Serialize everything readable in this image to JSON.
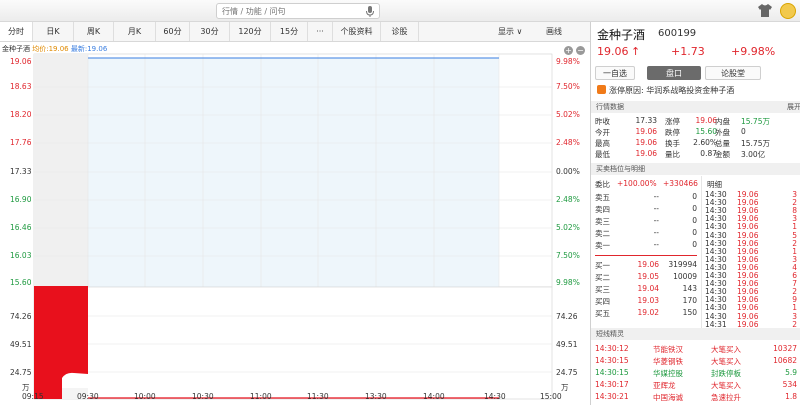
{
  "search": {
    "placeholder": "行情 / 功能 / 问句"
  },
  "tabs": [
    {
      "label": "分时",
      "active": true
    },
    {
      "label": "日K"
    },
    {
      "label": "周K"
    },
    {
      "label": "月K"
    },
    {
      "label": "60分"
    },
    {
      "label": "30分"
    },
    {
      "label": "120分"
    },
    {
      "label": "15分"
    },
    {
      "label": "···"
    },
    {
      "label": "个股资料"
    },
    {
      "label": "诊股"
    }
  ],
  "tab_dropdown": "显示 ∨",
  "tab_draw": "画线",
  "chart": {
    "legend_name": "金种子酒",
    "legend_avg": "均价:19.06",
    "legend_last": "最新:19.06",
    "price_levels": [
      "19.06",
      "18.63",
      "18.20",
      "17.76",
      "17.33",
      "16.90",
      "16.46",
      "16.03",
      "15.60"
    ],
    "pct_levels": [
      "9.98%",
      "7.50%",
      "5.02%",
      "2.48%",
      "0.00%",
      "2.48%",
      "5.02%",
      "7.50%",
      "9.98%"
    ],
    "vol_levels": [
      "74.26",
      "49.51",
      "24.75",
      "万"
    ],
    "time_labels": [
      "09:15",
      "09:30",
      "10:00",
      "10:30",
      "11:00",
      "11:30",
      "13:30",
      "14:00",
      "14:30",
      "15:00"
    ],
    "zoom_in": "+",
    "zoom_out": "−"
  },
  "chart_data": {
    "type": "line",
    "title": "金种子酒",
    "prev_close": 17.33,
    "x": [
      "09:15",
      "09:30",
      "10:00",
      "10:30",
      "11:00",
      "11:30",
      "13:30",
      "14:00",
      "14:30",
      "15:00"
    ],
    "price_range": [
      15.6,
      19.06
    ],
    "pct_range": [
      -9.98,
      9.98
    ],
    "series": [
      {
        "name": "最新",
        "values": [
          19.06,
          19.06
        ]
      },
      {
        "name": "均价",
        "values": [
          19.06,
          19.06
        ]
      }
    ],
    "volume_range_wan": [
      0,
      99.01
    ]
  },
  "stock": {
    "name": "金种子酒",
    "code": "600199",
    "price": "19.06",
    "arrow": "↑",
    "change": "+1.73",
    "change_pct": "+9.98%"
  },
  "panel_buttons": [
    "一自选",
    "盘口",
    "论股堂"
  ],
  "limit_reason": "涨停原因: 华润系战略投资金种子酒",
  "quote_header": "行情数据",
  "quote_header_right": "展开",
  "quote_rows": [
    [
      "昨收",
      "17.33",
      "涨停",
      "19.06",
      "内盘",
      "15.75万"
    ],
    [
      "今开",
      "19.06",
      "跌停",
      "15.60",
      "外盘",
      "0"
    ],
    [
      "最高",
      "19.06",
      "换手",
      "2.60%",
      "总量",
      "15.75万"
    ],
    [
      "最低",
      "19.06",
      "量比",
      "0.87",
      "金额",
      "3.00亿"
    ]
  ],
  "orderbook_header": "买卖档位与明细",
  "weibi": {
    "label": "委比",
    "pct": "+100.00%",
    "diff": "+330466"
  },
  "sells": [
    {
      "label": "卖五",
      "price": "--",
      "vol": "0"
    },
    {
      "label": "卖四",
      "price": "--",
      "vol": "0"
    },
    {
      "label": "卖三",
      "price": "--",
      "vol": "0"
    },
    {
      "label": "卖二",
      "price": "--",
      "vol": "0"
    },
    {
      "label": "卖一",
      "price": "--",
      "vol": "0"
    }
  ],
  "buys": [
    {
      "label": "买一",
      "price": "19.06",
      "vol": "319994"
    },
    {
      "label": "买二",
      "price": "19.05",
      "vol": "10009"
    },
    {
      "label": "买三",
      "price": "19.04",
      "vol": "143"
    },
    {
      "label": "买四",
      "price": "19.03",
      "vol": "170"
    },
    {
      "label": "买五",
      "price": "19.02",
      "vol": "150"
    }
  ],
  "detail_header": "明细",
  "details": [
    {
      "time": "14:30",
      "price": "19.06",
      "vol": "3"
    },
    {
      "time": "14:30",
      "price": "19.06",
      "vol": "2"
    },
    {
      "time": "14:30",
      "price": "19.06",
      "vol": "8"
    },
    {
      "time": "14:30",
      "price": "19.06",
      "vol": "3"
    },
    {
      "time": "14:30",
      "price": "19.06",
      "vol": "1"
    },
    {
      "time": "14:30",
      "price": "19.06",
      "vol": "5"
    },
    {
      "time": "14:30",
      "price": "19.06",
      "vol": "2"
    },
    {
      "time": "14:30",
      "price": "19.06",
      "vol": "1"
    },
    {
      "time": "14:30",
      "price": "19.06",
      "vol": "3"
    },
    {
      "time": "14:30",
      "price": "19.06",
      "vol": "4"
    },
    {
      "time": "14:30",
      "price": "19.06",
      "vol": "6"
    },
    {
      "time": "14:30",
      "price": "19.06",
      "vol": "7"
    },
    {
      "time": "14:30",
      "price": "19.06",
      "vol": "2"
    },
    {
      "time": "14:30",
      "price": "19.06",
      "vol": "9"
    },
    {
      "time": "14:30",
      "price": "19.06",
      "vol": "1"
    },
    {
      "time": "14:30",
      "price": "19.06",
      "vol": "3"
    },
    {
      "time": "14:31",
      "price": "19.06",
      "vol": "2"
    }
  ],
  "block_header": "短线精灵",
  "block_rows": [
    {
      "time": "14:30:12",
      "name": "节能铁汉",
      "action": "大笔买入",
      "value": "10327"
    },
    {
      "time": "14:30:15",
      "name": "华菱钢铁",
      "action": "大笔买入",
      "value": "10682"
    },
    {
      "time": "14:30:15",
      "name": "华媒控股",
      "action": "封跌停板",
      "value": "5.9"
    },
    {
      "time": "14:30:17",
      "name": "亚辉龙",
      "action": "大笔买入",
      "value": "534"
    },
    {
      "time": "14:30:21",
      "name": "中国海诚",
      "action": "急速拉升",
      "value": "1.8"
    }
  ],
  "colors": {
    "up": "#e0262d",
    "down": "#1f9a40",
    "avg": "#e08a00",
    "last": "#3a7ee0"
  }
}
